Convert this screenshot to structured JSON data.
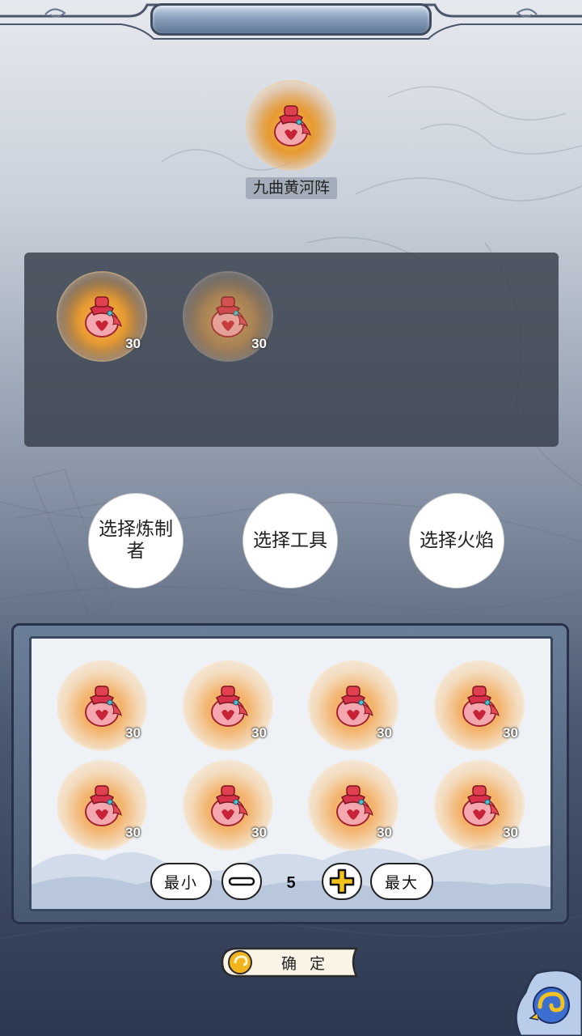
{
  "formation": {
    "name": "九曲黄河阵"
  },
  "slots": [
    {
      "count": "30",
      "state": "active"
    },
    {
      "count": "30",
      "state": "dim"
    }
  ],
  "actions": {
    "select_refiner": "选择炼制者",
    "select_tool": "选择工具",
    "select_flame": "选择火焰"
  },
  "inventory": {
    "items": [
      {
        "count": "30"
      },
      {
        "count": "30"
      },
      {
        "count": "30"
      },
      {
        "count": "30"
      },
      {
        "count": "30"
      },
      {
        "count": "30"
      },
      {
        "count": "30"
      },
      {
        "count": "30"
      }
    ]
  },
  "quantity": {
    "min_label": "最小",
    "max_label": "最大",
    "value": "5"
  },
  "confirm_label": "确定",
  "icons": {
    "item": "red-pouch-icon",
    "minus": "minus-icon",
    "plus": "plus-icon",
    "back": "swirl-back-icon"
  },
  "colors": {
    "orb_gold": "#e79a32",
    "pouch_red": "#d8324a",
    "plus_gold": "#f2c21a"
  }
}
